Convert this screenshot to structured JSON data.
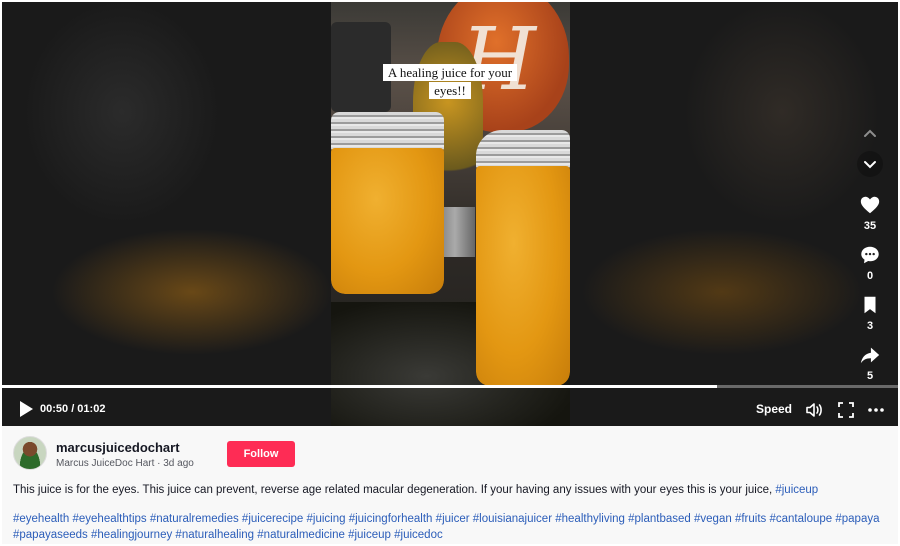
{
  "video": {
    "overlay_caption": "A healing juice for your eyes!!",
    "progress": 0.798,
    "current_time": "00:50",
    "duration": "01:02",
    "time_display": "00:50 / 01:02",
    "speed_label": "Speed"
  },
  "actions": {
    "likes": "35",
    "comments": "0",
    "saves": "3",
    "shares": "5"
  },
  "author": {
    "username": "marcusjuicedochart",
    "display_name": "Marcus JuiceDoc Hart",
    "posted": "3d ago",
    "subline": "Marcus JuiceDoc Hart · 3d ago",
    "follow_label": "Follow"
  },
  "description": {
    "text": "This juice is for the eyes. This juice can prevent, reverse age related macular degeneration. If your having any issues with your eyes this is your juice, ",
    "inline_tag": "#juiceup"
  },
  "hashtags": [
    "#eyehealth",
    "#eyehealthtips",
    "#naturalremedies",
    "#juicerecipe",
    "#juicing",
    "#juicingforhealth",
    "#juicer",
    "#louisianajuicer",
    "#healthyliving",
    "#plantbased",
    "#vegan",
    "#fruits",
    "#cantaloupe",
    "#papaya",
    "#papayaseeds",
    "#healingjourney",
    "#naturalhealing",
    "#naturalmedicine",
    "#juiceup",
    "#juicedoc"
  ],
  "colors": {
    "follow_button": "#fe2c55",
    "hashtag": "#2b5db9"
  }
}
